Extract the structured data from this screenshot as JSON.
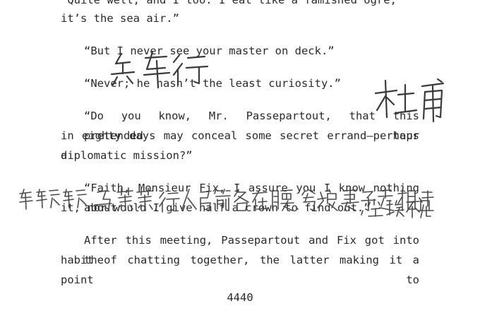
{
  "document": {
    "lines": [
      "“Quite well, and I too. I eat like a famished ogre;",
      "it’s the sea air.”",
      "“But I never see your master on deck.”",
      "“Never; he hasn’t the least curiosity.”",
      "“Do you know, Mr. Passepartout, that this pretended tour",
      "in eighty days may conceal some secret errand—perhaps a",
      "diplomatic mission?”",
      "“Faith, Monsieur Fix, I assure you I know nothing about",
      "it, nor would I give half a crown to find out.”",
      "After this meeting, Passepartout and Fix got into the",
      "habit of chatting together, the latter making it a point to"
    ],
    "page_number": "4440"
  },
  "handwriting": {
    "note_1": "兵车行",
    "note_2": "杜甫",
    "note_3": "车辚辚，马萧萧，行人弓箭各在腰。爷娘妻子走相送，尘埃不见"
  }
}
